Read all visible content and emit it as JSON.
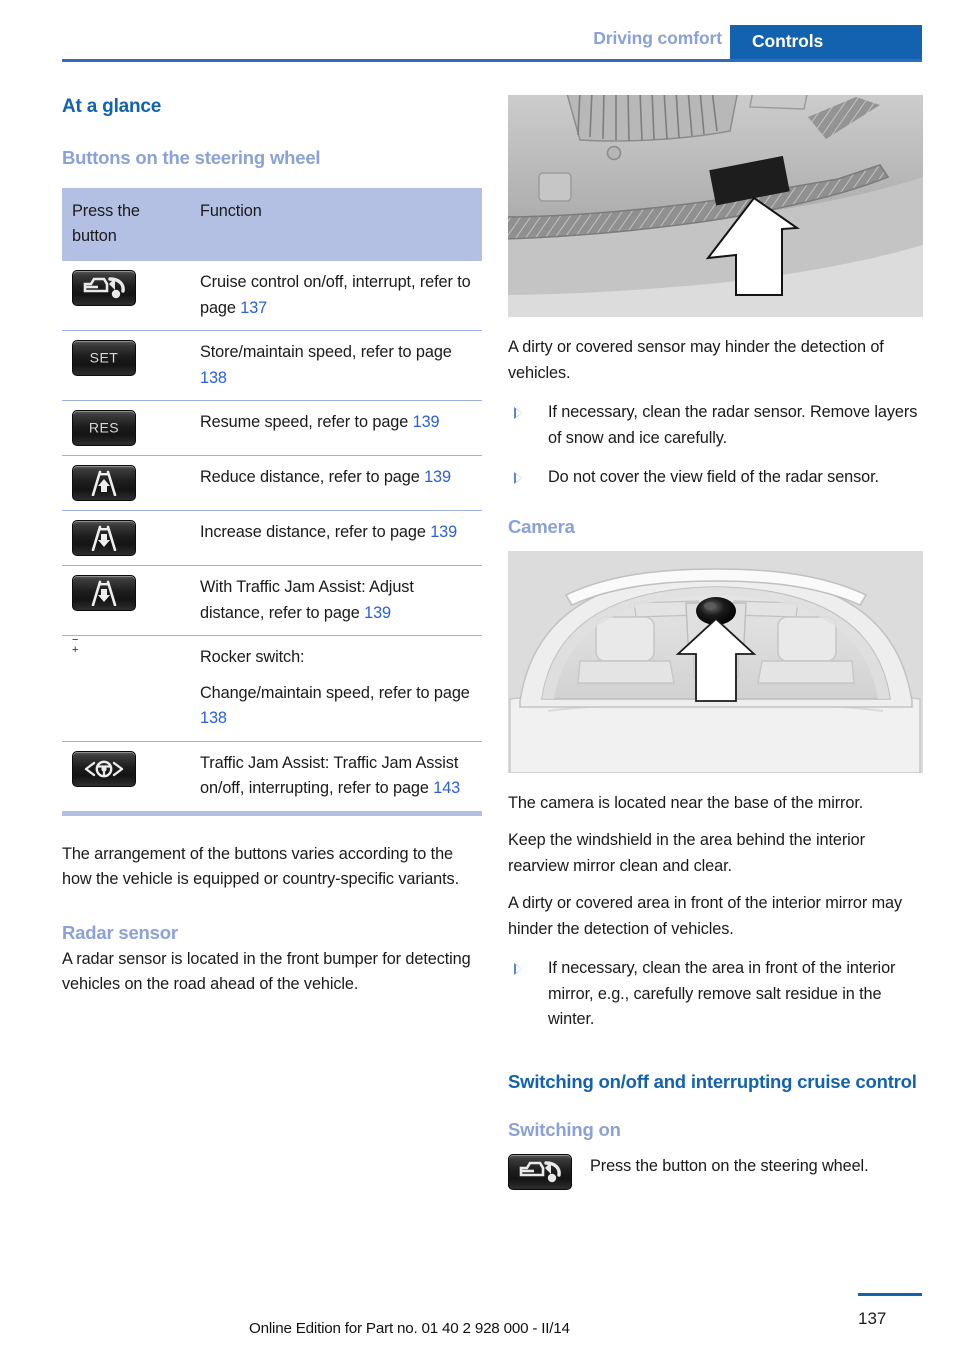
{
  "header": {
    "chapter": "Driving comfort",
    "section": "Controls",
    "accent_blue": "#1362b0",
    "light_blue": "#8ba1d8"
  },
  "left_column": {
    "title": "At a glance",
    "subtitle": "Buttons on the steering wheel",
    "table": {
      "columns": [
        "Press the button",
        "Function"
      ],
      "rows": [
        {
          "icon": "cruise-control-button-icon",
          "icon_label": "",
          "text_before": "Cruise control on/off, interrupt, refer to page ",
          "page": "137",
          "text_after": ""
        },
        {
          "icon": "set-button-icon",
          "icon_label": "SET",
          "text_before": "Store/maintain speed, refer to page ",
          "page": "138",
          "text_after": ""
        },
        {
          "icon": "res-button-icon",
          "icon_label": "RES",
          "text_before": "Resume speed, refer to page ",
          "page": "139",
          "text_after": ""
        },
        {
          "icon": "reduce-distance-button-icon",
          "icon_label": "",
          "text_before": "Reduce distance, refer to page ",
          "page": "139",
          "text_after": ""
        },
        {
          "icon": "increase-distance-button-icon",
          "icon_label": "",
          "text_before": "Increase distance, refer to page ",
          "page": "139",
          "text_after": ""
        },
        {
          "icon": "adjust-distance-button-icon",
          "icon_label": "",
          "text_before": "With Traffic Jam Assist: Adjust distance, refer to page ",
          "page": "139",
          "text_after": ""
        },
        {
          "icon": "rocker-switch-icon",
          "icon_label": "",
          "text_before": "Rocker switch:",
          "page": "",
          "text_after": "",
          "second_line_before": "Change/maintain speed, refer to page ",
          "second_page": "138"
        },
        {
          "icon": "traffic-jam-assist-button-icon",
          "icon_label": "",
          "text_before": "Traffic Jam Assist: Traffic Jam Assist on/off, interrupting, refer to page ",
          "page": "143",
          "text_after": ""
        }
      ]
    },
    "note": "The arrangement of the buttons varies according to the how the vehicle is equipped or country-specific variants.",
    "radar": {
      "heading": "Radar sensor",
      "body": "A radar sensor is located in the front bumper for detecting vehicles on the road ahead of the vehicle."
    }
  },
  "right_column": {
    "bumper_figure_alt": "front bumper with radar sensor and arrow",
    "radar_note": "A dirty or covered sensor may hinder the detection of vehicles.",
    "radar_bullets": [
      "If necessary, clean the radar sensor. Remove layers of snow and ice carefully.",
      "Do not cover the view field of the radar sensor."
    ],
    "camera": {
      "heading": "Camera",
      "figure_alt": "windshield interior with camera near rearview mirror and arrow",
      "paragraphs": [
        "The camera is located near the base of the mirror.",
        "Keep the windshield in the area behind the interior rearview mirror clean and clear.",
        "A dirty or covered area in front of the interior mirror may hinder the detection of vehicles."
      ],
      "bullets": [
        "If necessary, clean the area in front of the interior mirror, e.g., carefully remove salt residue in the winter."
      ]
    },
    "switching": {
      "heading": "Switching on/off and interrupting cruise control",
      "subheading": "Switching on",
      "step_icon": "cruise-control-button-icon",
      "step_text": "Press the button on the steering wheel."
    }
  },
  "footer": {
    "edition": "Online Edition for Part no. 01 40 2 928 000 - II/14",
    "page_number": "137"
  }
}
